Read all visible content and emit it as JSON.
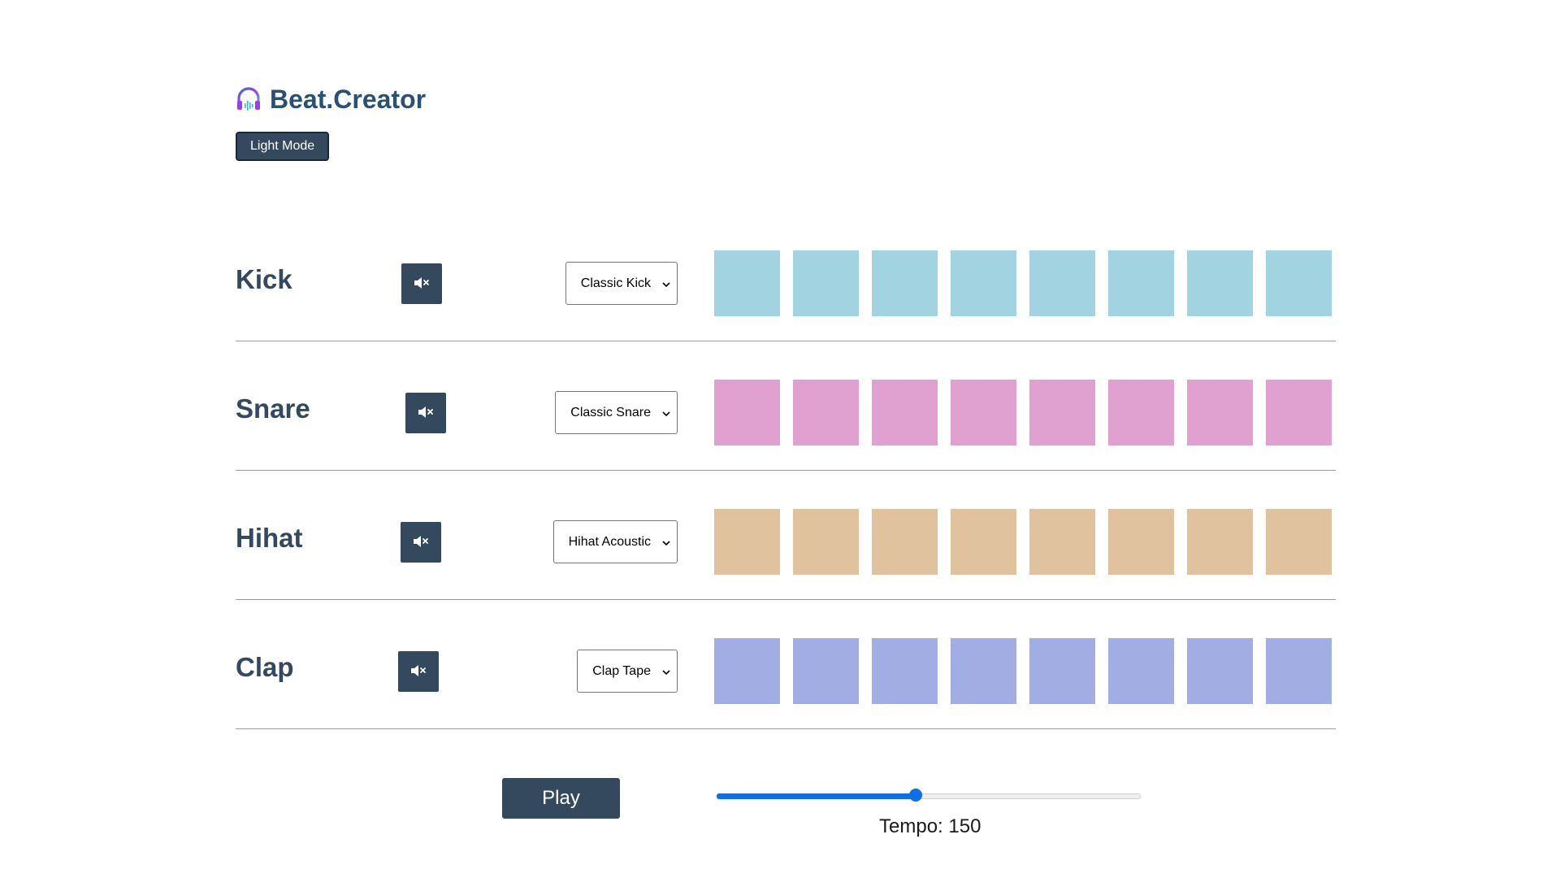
{
  "header": {
    "title": "Beat.Creator",
    "logo_icon": "headphones-icon",
    "mode_button_label": "Light Mode"
  },
  "tracks": [
    {
      "name": "Kick",
      "mute_icon": "speaker-mute-icon",
      "sound_selected": "Classic Kick",
      "pad_color": "#a1d3e0",
      "pad_count": 8
    },
    {
      "name": "Snare",
      "mute_icon": "speaker-mute-icon",
      "sound_selected": "Classic Snare",
      "pad_color": "#e0a1d1",
      "pad_count": 8
    },
    {
      "name": "Hihat",
      "mute_icon": "speaker-mute-icon",
      "sound_selected": "Hihat Acoustic",
      "pad_color": "#e0c29f",
      "pad_count": 8
    },
    {
      "name": "Clap",
      "mute_icon": "speaker-mute-icon",
      "sound_selected": "Clap Tape",
      "pad_color": "#a2aee3",
      "pad_count": 8
    }
  ],
  "controls": {
    "play_label": "Play",
    "tempo_label": "Tempo: 150",
    "tempo_fill_fraction": 0.47,
    "slider_color": "#0f6fe6"
  },
  "colors": {
    "dark": "#34495e",
    "title": "#2a5173"
  }
}
